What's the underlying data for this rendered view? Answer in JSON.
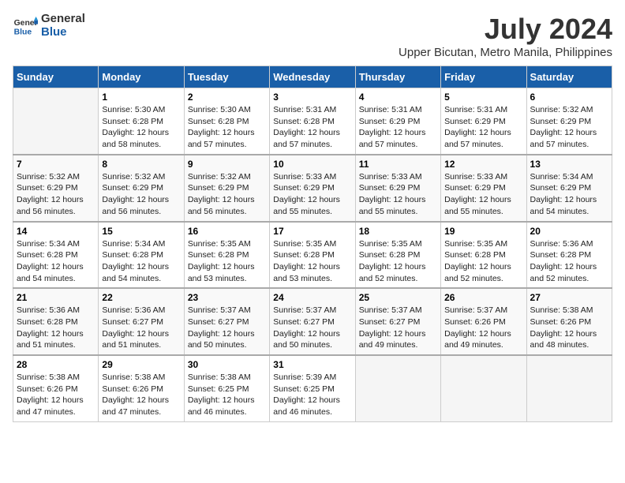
{
  "logo": {
    "line1": "General",
    "line2": "Blue"
  },
  "title": "July 2024",
  "subtitle": "Upper Bicutan, Metro Manila, Philippines",
  "days_of_week": [
    "Sunday",
    "Monday",
    "Tuesday",
    "Wednesday",
    "Thursday",
    "Friday",
    "Saturday"
  ],
  "weeks": [
    [
      {
        "date": "",
        "info": ""
      },
      {
        "date": "1",
        "info": "Sunrise: 5:30 AM\nSunset: 6:28 PM\nDaylight: 12 hours\nand 58 minutes."
      },
      {
        "date": "2",
        "info": "Sunrise: 5:30 AM\nSunset: 6:28 PM\nDaylight: 12 hours\nand 57 minutes."
      },
      {
        "date": "3",
        "info": "Sunrise: 5:31 AM\nSunset: 6:28 PM\nDaylight: 12 hours\nand 57 minutes."
      },
      {
        "date": "4",
        "info": "Sunrise: 5:31 AM\nSunset: 6:29 PM\nDaylight: 12 hours\nand 57 minutes."
      },
      {
        "date": "5",
        "info": "Sunrise: 5:31 AM\nSunset: 6:29 PM\nDaylight: 12 hours\nand 57 minutes."
      },
      {
        "date": "6",
        "info": "Sunrise: 5:32 AM\nSunset: 6:29 PM\nDaylight: 12 hours\nand 57 minutes."
      }
    ],
    [
      {
        "date": "7",
        "info": "Sunrise: 5:32 AM\nSunset: 6:29 PM\nDaylight: 12 hours\nand 56 minutes."
      },
      {
        "date": "8",
        "info": "Sunrise: 5:32 AM\nSunset: 6:29 PM\nDaylight: 12 hours\nand 56 minutes."
      },
      {
        "date": "9",
        "info": "Sunrise: 5:32 AM\nSunset: 6:29 PM\nDaylight: 12 hours\nand 56 minutes."
      },
      {
        "date": "10",
        "info": "Sunrise: 5:33 AM\nSunset: 6:29 PM\nDaylight: 12 hours\nand 55 minutes."
      },
      {
        "date": "11",
        "info": "Sunrise: 5:33 AM\nSunset: 6:29 PM\nDaylight: 12 hours\nand 55 minutes."
      },
      {
        "date": "12",
        "info": "Sunrise: 5:33 AM\nSunset: 6:29 PM\nDaylight: 12 hours\nand 55 minutes."
      },
      {
        "date": "13",
        "info": "Sunrise: 5:34 AM\nSunset: 6:29 PM\nDaylight: 12 hours\nand 54 minutes."
      }
    ],
    [
      {
        "date": "14",
        "info": "Sunrise: 5:34 AM\nSunset: 6:28 PM\nDaylight: 12 hours\nand 54 minutes."
      },
      {
        "date": "15",
        "info": "Sunrise: 5:34 AM\nSunset: 6:28 PM\nDaylight: 12 hours\nand 54 minutes."
      },
      {
        "date": "16",
        "info": "Sunrise: 5:35 AM\nSunset: 6:28 PM\nDaylight: 12 hours\nand 53 minutes."
      },
      {
        "date": "17",
        "info": "Sunrise: 5:35 AM\nSunset: 6:28 PM\nDaylight: 12 hours\nand 53 minutes."
      },
      {
        "date": "18",
        "info": "Sunrise: 5:35 AM\nSunset: 6:28 PM\nDaylight: 12 hours\nand 52 minutes."
      },
      {
        "date": "19",
        "info": "Sunrise: 5:35 AM\nSunset: 6:28 PM\nDaylight: 12 hours\nand 52 minutes."
      },
      {
        "date": "20",
        "info": "Sunrise: 5:36 AM\nSunset: 6:28 PM\nDaylight: 12 hours\nand 52 minutes."
      }
    ],
    [
      {
        "date": "21",
        "info": "Sunrise: 5:36 AM\nSunset: 6:28 PM\nDaylight: 12 hours\nand 51 minutes."
      },
      {
        "date": "22",
        "info": "Sunrise: 5:36 AM\nSunset: 6:27 PM\nDaylight: 12 hours\nand 51 minutes."
      },
      {
        "date": "23",
        "info": "Sunrise: 5:37 AM\nSunset: 6:27 PM\nDaylight: 12 hours\nand 50 minutes."
      },
      {
        "date": "24",
        "info": "Sunrise: 5:37 AM\nSunset: 6:27 PM\nDaylight: 12 hours\nand 50 minutes."
      },
      {
        "date": "25",
        "info": "Sunrise: 5:37 AM\nSunset: 6:27 PM\nDaylight: 12 hours\nand 49 minutes."
      },
      {
        "date": "26",
        "info": "Sunrise: 5:37 AM\nSunset: 6:26 PM\nDaylight: 12 hours\nand 49 minutes."
      },
      {
        "date": "27",
        "info": "Sunrise: 5:38 AM\nSunset: 6:26 PM\nDaylight: 12 hours\nand 48 minutes."
      }
    ],
    [
      {
        "date": "28",
        "info": "Sunrise: 5:38 AM\nSunset: 6:26 PM\nDaylight: 12 hours\nand 47 minutes."
      },
      {
        "date": "29",
        "info": "Sunrise: 5:38 AM\nSunset: 6:26 PM\nDaylight: 12 hours\nand 47 minutes."
      },
      {
        "date": "30",
        "info": "Sunrise: 5:38 AM\nSunset: 6:25 PM\nDaylight: 12 hours\nand 46 minutes."
      },
      {
        "date": "31",
        "info": "Sunrise: 5:39 AM\nSunset: 6:25 PM\nDaylight: 12 hours\nand 46 minutes."
      },
      {
        "date": "",
        "info": ""
      },
      {
        "date": "",
        "info": ""
      },
      {
        "date": "",
        "info": ""
      }
    ]
  ]
}
